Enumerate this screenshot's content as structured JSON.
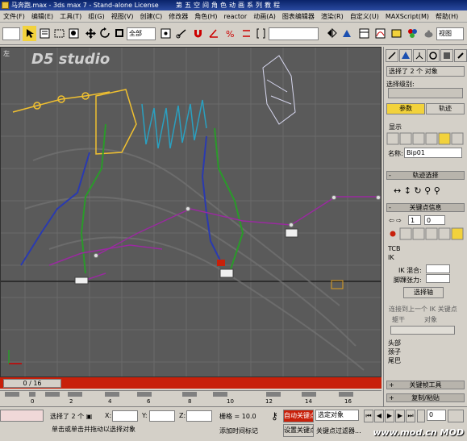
{
  "window": {
    "title": "马奔跑.max - 3ds max 7 - Stand-alone License",
    "banner": "第五空间角色动画系列教程"
  },
  "menu": [
    "文件(F)",
    "编辑(E)",
    "工具(T)",
    "组(G)",
    "视图(V)",
    "创建(C)",
    "修改器",
    "角色(H)",
    "reactor",
    "动画(A)",
    "图表编辑器",
    "渲染(R)",
    "自定义(U)",
    "MAXScript(M)",
    "帮助(H)"
  ],
  "toolbar": {
    "selection_filter": "全部",
    "view_dropdown": "屏幕",
    "named_selection": "",
    "render_type": "视图"
  },
  "viewport": {
    "label": "左",
    "logo": "D5 studio",
    "frame_indicator": "0 / 16"
  },
  "timeline": {
    "ticks": [
      "0",
      "2",
      "4",
      "6",
      "8",
      "10",
      "12",
      "14",
      "16"
    ]
  },
  "status": {
    "selected": "选择了 2 个 ▣",
    "x_label": "X:",
    "y_label": "Y:",
    "z_label": "Z:",
    "grid": "栅格 = 10.0",
    "prompt": "单击或单击并拖动以选择对象",
    "add_time_tag": "添加时间标记",
    "auto_key": "自动关键点",
    "set_key": "设置关键点",
    "selected_obj": "选定对象",
    "key_filters": "关键点过滤器...",
    "frame": "0",
    "watermark": "www.mod.cn  MOD"
  },
  "panel": {
    "selected_count": "选择了 2 个 对象",
    "selection_level": "选择级别:",
    "tab_params": "参数",
    "tab_trajectory": "轨迹",
    "display_label": "显示",
    "name_label": "名称:",
    "name_value": "Bip01",
    "rollout_track_select": "轨迹选择",
    "rollout_key_info": "关键点信息",
    "key_number": "1",
    "key_time": "0",
    "tcb_label": "TCB",
    "ik_label": "IK",
    "ik_blend_label": "IK 混合:",
    "ankle_tension_label": "脚踝张力:",
    "pivot_btn": "选择轴",
    "prev_ik_label": "连接到上一个 IK 关键点",
    "body_label": "躯干",
    "object_label": "对象",
    "head_label": "头部",
    "neck_label": "颈子",
    "tail_label": "尾巴",
    "rollout_keyframe_tools": "关键帧工具",
    "rollout_copy_paste": "复制/粘贴"
  },
  "colors": {
    "accent_red": "#c8200a",
    "viewport_bg": "#5a5a5a",
    "title_blue": "#0a246a"
  }
}
